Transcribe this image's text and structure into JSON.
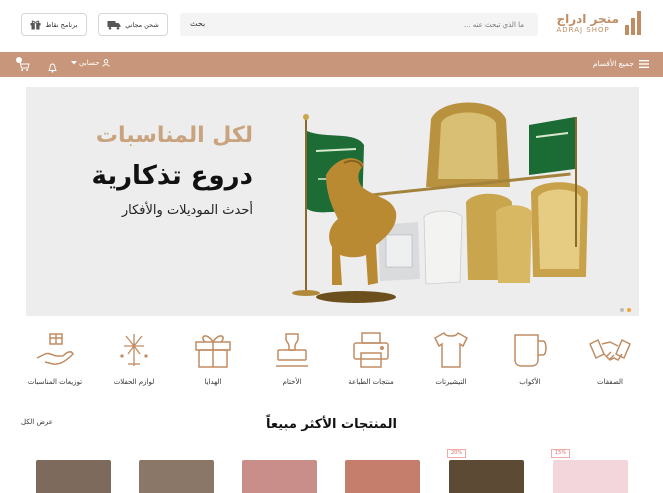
{
  "header": {
    "logo": {
      "arabic": "متجر ادراج",
      "english": "ADRAJ SHOP"
    },
    "search": {
      "placeholder": "ما الذي تبحث عنه ...",
      "button_label": "بحث"
    },
    "shipping_button": "شحن مجاني",
    "points_button": "برنامج نقاط"
  },
  "navbar": {
    "all_categories": "جميع الأقسام",
    "account": "حسابي"
  },
  "banner": {
    "line1": "لكل المناسبات",
    "line2": "دروع تذكارية",
    "line3": "أحدث الموديلات والأفكار",
    "active_slide": 1,
    "slides": 2
  },
  "categories": [
    {
      "label": "الصفقات",
      "icon": "handshake-icon"
    },
    {
      "label": "الأكواب",
      "icon": "mug-icon"
    },
    {
      "label": "التيشيرتات",
      "icon": "tshirt-icon"
    },
    {
      "label": "منتجات الطباعة",
      "icon": "printer-icon"
    },
    {
      "label": "الأختام",
      "icon": "stamp-icon"
    },
    {
      "label": "الهدايا",
      "icon": "gift-icon"
    },
    {
      "label": "لوازم الحفلات",
      "icon": "fireworks-icon"
    },
    {
      "label": "توزيعات المناسبات",
      "icon": "giveaway-hand-icon"
    }
  ],
  "best_sellers": {
    "title": "المنتجات الأكثر مبيعاً",
    "view_all": "عرض الكل",
    "badges": [
      "20%",
      "15%"
    ]
  },
  "colors": {
    "accent": "#c8967a",
    "logo": "#c08c63",
    "icon_stroke": "#c08c63",
    "dot_active": "#f0a53b"
  }
}
